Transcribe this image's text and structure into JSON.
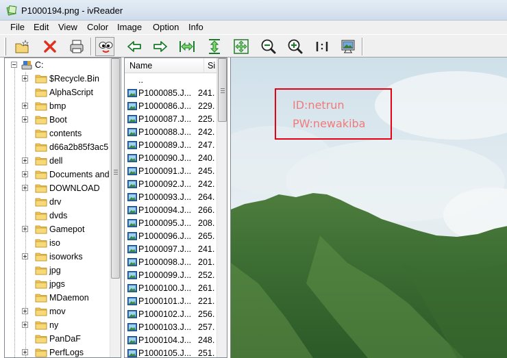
{
  "window": {
    "title": "P1000194.png - ivReader"
  },
  "menu": [
    "File",
    "Edit",
    "View",
    "Color",
    "Image",
    "Option",
    "Info"
  ],
  "toolbar": {
    "icons": [
      "open-folder-icon",
      "close-x-icon",
      "print-icon",
      "eyes-icon",
      "arrow-left-icon",
      "arrow-right-icon",
      "fit-width-icon",
      "fit-height-icon",
      "fit-window-icon",
      "zoom-out-icon",
      "zoom-in-icon",
      "actual-size-icon",
      "slideshow-icon"
    ]
  },
  "tree": {
    "root": "C:",
    "items": [
      {
        "label": "$Recycle.Bin",
        "expandable": true
      },
      {
        "label": "AlphaScript",
        "expandable": false
      },
      {
        "label": "bmp",
        "expandable": true
      },
      {
        "label": "Boot",
        "expandable": true
      },
      {
        "label": "contents",
        "expandable": false
      },
      {
        "label": "d66a2b85f3ac5",
        "expandable": false
      },
      {
        "label": "dell",
        "expandable": true
      },
      {
        "label": "Documents and",
        "expandable": true
      },
      {
        "label": "DOWNLOAD",
        "expandable": true
      },
      {
        "label": "drv",
        "expandable": false
      },
      {
        "label": "dvds",
        "expandable": false
      },
      {
        "label": "Gamepot",
        "expandable": true
      },
      {
        "label": "iso",
        "expandable": false
      },
      {
        "label": "isoworks",
        "expandable": true
      },
      {
        "label": "jpg",
        "expandable": false
      },
      {
        "label": "jpgs",
        "expandable": false
      },
      {
        "label": "MDaemon",
        "expandable": false
      },
      {
        "label": "mov",
        "expandable": true
      },
      {
        "label": "ny",
        "expandable": true
      },
      {
        "label": "PanDaF",
        "expandable": false
      },
      {
        "label": "PerfLogs",
        "expandable": true
      }
    ]
  },
  "filelist": {
    "columns": {
      "name": "Name",
      "size": "Si"
    },
    "parent": "..",
    "rows": [
      {
        "name": "P1000085.J...",
        "size": "241."
      },
      {
        "name": "P1000086.J...",
        "size": "229."
      },
      {
        "name": "P1000087.J...",
        "size": "225."
      },
      {
        "name": "P1000088.J...",
        "size": "242."
      },
      {
        "name": "P1000089.J...",
        "size": "247."
      },
      {
        "name": "P1000090.J...",
        "size": "240."
      },
      {
        "name": "P1000091.J...",
        "size": "245."
      },
      {
        "name": "P1000092.J...",
        "size": "242."
      },
      {
        "name": "P1000093.J...",
        "size": "264."
      },
      {
        "name": "P1000094.J...",
        "size": "266."
      },
      {
        "name": "P1000095.J...",
        "size": "208."
      },
      {
        "name": "P1000096.J...",
        "size": "265."
      },
      {
        "name": "P1000097.J...",
        "size": "241."
      },
      {
        "name": "P1000098.J...",
        "size": "201."
      },
      {
        "name": "P1000099.J...",
        "size": "252."
      },
      {
        "name": "P1000100.J...",
        "size": "261."
      },
      {
        "name": "P1000101.J...",
        "size": "221."
      },
      {
        "name": "P1000102.J...",
        "size": "256."
      },
      {
        "name": "P1000103.J...",
        "size": "257."
      },
      {
        "name": "P1000104.J...",
        "size": "248."
      },
      {
        "name": "P1000105.J...",
        "size": "251."
      }
    ]
  },
  "image": {
    "annotation_lines": [
      "ID:netrun",
      "PW:newakiba"
    ],
    "annotation_color": "#e60012"
  }
}
